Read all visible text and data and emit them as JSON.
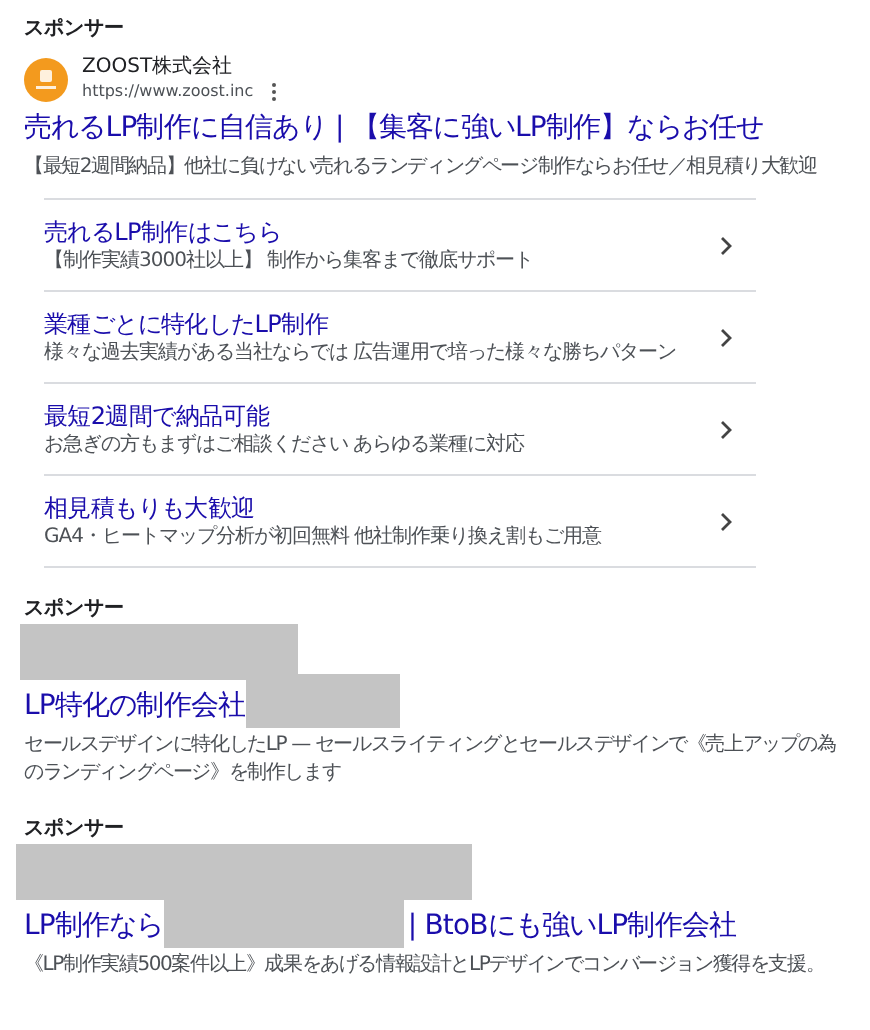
{
  "ads": [
    {
      "kind": "full",
      "sponsor_label": "スポンサー",
      "advertiser": "ZOOST株式会社",
      "url": "https://www.zoost.inc",
      "title": [
        {
          "kind": "text",
          "text": "売れるLP制作に自信あり | 【集客に強いLP制作】ならお任せ"
        }
      ],
      "description": "【最短2週間納品】他社に負けない売れるランディングページ制作ならお任せ／相見積り大歓迎",
      "sitelinks": [
        {
          "title": "売れるLP制作はこちら",
          "description": "【制作実績3000社以上】 制作から集客まで徹底サポート"
        },
        {
          "title": "業種ごとに特化したLP制作",
          "description": "様々な過去実績がある当社ならでは 広告運用で培った様々な勝ちパターン"
        },
        {
          "title": "最短2週間で納品可能",
          "description": "お急ぎの方もまずはご相談ください あらゆる業種に対応"
        },
        {
          "title": "相見積もりも大歓迎",
          "description": "GA4・ヒートマップ分析が初回無料 他社制作乗り換え割もご用意"
        }
      ]
    },
    {
      "kind": "redacted",
      "sponsor_label": "スポンサー",
      "title": [
        {
          "kind": "text",
          "text": "LP特化の制作会社"
        },
        {
          "kind": "redacted"
        }
      ],
      "description": "セールスデザインに特化したLP — セールスライティングとセールスデザインで《売上アップの為のランディングページ》を制作します"
    },
    {
      "kind": "redacted",
      "sponsor_label": "スポンサー",
      "title": [
        {
          "kind": "text",
          "text": "LP制作なら"
        },
        {
          "kind": "redacted"
        },
        {
          "kind": "text",
          "text": "| BtoBにも強いLP制作会社"
        }
      ],
      "description": "《LP制作実績500案件以上》成果をあげる情報設計とLPデザインでコンバージョン獲得を支援。"
    }
  ]
}
